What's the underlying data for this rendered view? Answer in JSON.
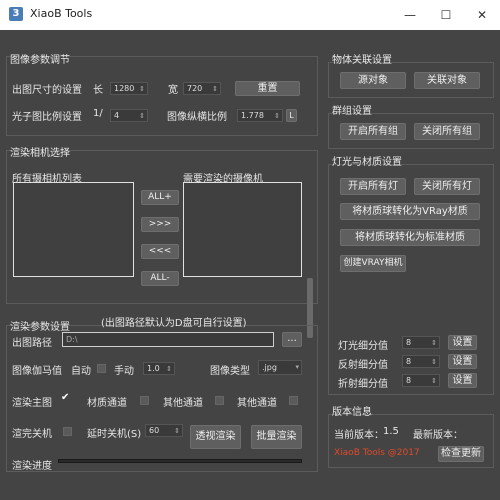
{
  "window": {
    "title": "XiaoB Tools",
    "icon_text": "3",
    "minimize": "—",
    "maximize": "☐",
    "close": "✕"
  },
  "image_params": {
    "title": "图像参数调节",
    "output_size_label": "出图尺寸的设置",
    "length_label": "长",
    "width_value": "1280",
    "width_label": "宽",
    "height_value": "720",
    "reset_button": "重置",
    "photon_label": "光子图比例设置",
    "photon_prefix": "1/",
    "photon_value": "4",
    "aspect_label": "图像纵横比例",
    "aspect_value": "1.778",
    "lock_label": "L"
  },
  "camera_select": {
    "title": "渲染相机选择",
    "all_cameras_label": "所有摄相机列表",
    "render_cameras_label": "需要渲染的摄像机",
    "all_add_button": "ALL+",
    "add_button": ">>>",
    "remove_button": "<<<",
    "all_remove_button": "ALL-"
  },
  "render_params": {
    "title": "渲染参数设置",
    "path_note": "(出图路径默认为D盘可自行设置)",
    "path_label": "出图路径",
    "path_value": "D:\\",
    "browse_button": "...",
    "gamma_label": "图像伽马值",
    "auto_label": "自动",
    "manual_label": "手动",
    "gamma_value": "1.0",
    "image_type_label": "图像类型",
    "image_type_value": ".jpg",
    "render_main_label": "渲染主图",
    "material_channel_label": "材质通道",
    "other_channel1_label": "其他通道",
    "other_channel2_label": "其他通道",
    "shutdown_label": "渲完关机",
    "delay_shutdown_label": "延时关机(S)",
    "delay_value": "60",
    "perspective_render_button": "透视渲染",
    "batch_render_button": "批量渲染",
    "progress_label": "渲染进度",
    "progress": 0
  },
  "object_link": {
    "title": "物体关联设置",
    "source_button": "源对象",
    "link_button": "关联对象"
  },
  "group_settings": {
    "title": "群组设置",
    "open_all_button": "开启所有组",
    "close_all_button": "关闭所有组"
  },
  "light_material": {
    "title": "灯光与材质设置",
    "open_lights_button": "开启所有灯",
    "close_lights_button": "关闭所有灯",
    "to_vray_button": "将材质球转化为VRay材质",
    "to_standard_button": "将材质球转化为标准材质",
    "create_vray_camera_button": "创建VRAY相机",
    "light_subdiv_label": "灯光细分值",
    "light_subdiv_value": "8",
    "reflect_subdiv_label": "反射细分值",
    "reflect_subdiv_value": "8",
    "refract_subdiv_label": "折射细分值",
    "refract_subdiv_value": "8",
    "set_button": "设置"
  },
  "version": {
    "title": "版本信息",
    "current_label": "当前版本：",
    "current_value": "1.5",
    "latest_label": "最新版本：",
    "brand": "XiaoB Tools @2017",
    "check_update_button": "检查更新"
  }
}
